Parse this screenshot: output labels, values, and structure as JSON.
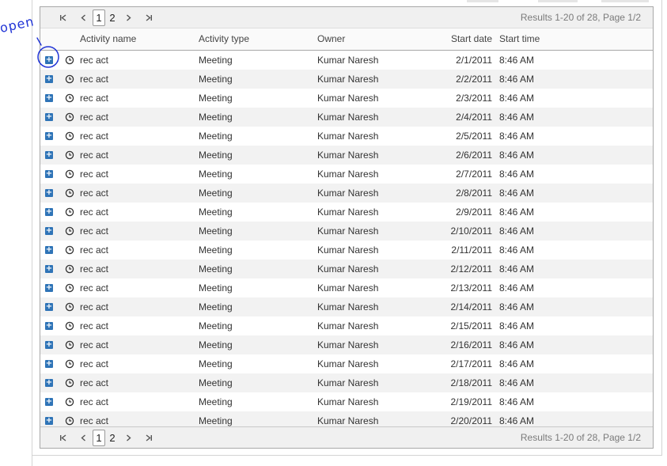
{
  "pager": {
    "pages": [
      "1",
      "2"
    ],
    "current_page": "1",
    "results_text": "Results 1-20 of 28, Page 1/2"
  },
  "annotation": {
    "text": "open"
  },
  "columns": {
    "activity_name": "Activity name",
    "activity_type": "Activity type",
    "owner": "Owner",
    "start_date": "Start date",
    "start_time": "Start time"
  },
  "rows": [
    {
      "name": "rec act",
      "type": "Meeting",
      "owner": "Kumar Naresh",
      "date": "2/1/2011",
      "time": "8:46 AM"
    },
    {
      "name": "rec act",
      "type": "Meeting",
      "owner": "Kumar Naresh",
      "date": "2/2/2011",
      "time": "8:46 AM"
    },
    {
      "name": "rec act",
      "type": "Meeting",
      "owner": "Kumar Naresh",
      "date": "2/3/2011",
      "time": "8:46 AM"
    },
    {
      "name": "rec act",
      "type": "Meeting",
      "owner": "Kumar Naresh",
      "date": "2/4/2011",
      "time": "8:46 AM"
    },
    {
      "name": "rec act",
      "type": "Meeting",
      "owner": "Kumar Naresh",
      "date": "2/5/2011",
      "time": "8:46 AM"
    },
    {
      "name": "rec act",
      "type": "Meeting",
      "owner": "Kumar Naresh",
      "date": "2/6/2011",
      "time": "8:46 AM"
    },
    {
      "name": "rec act",
      "type": "Meeting",
      "owner": "Kumar Naresh",
      "date": "2/7/2011",
      "time": "8:46 AM"
    },
    {
      "name": "rec act",
      "type": "Meeting",
      "owner": "Kumar Naresh",
      "date": "2/8/2011",
      "time": "8:46 AM"
    },
    {
      "name": "rec act",
      "type": "Meeting",
      "owner": "Kumar Naresh",
      "date": "2/9/2011",
      "time": "8:46 AM"
    },
    {
      "name": "rec act",
      "type": "Meeting",
      "owner": "Kumar Naresh",
      "date": "2/10/2011",
      "time": "8:46 AM"
    },
    {
      "name": "rec act",
      "type": "Meeting",
      "owner": "Kumar Naresh",
      "date": "2/11/2011",
      "time": "8:46 AM"
    },
    {
      "name": "rec act",
      "type": "Meeting",
      "owner": "Kumar Naresh",
      "date": "2/12/2011",
      "time": "8:46 AM"
    },
    {
      "name": "rec act",
      "type": "Meeting",
      "owner": "Kumar Naresh",
      "date": "2/13/2011",
      "time": "8:46 AM"
    },
    {
      "name": "rec act",
      "type": "Meeting",
      "owner": "Kumar Naresh",
      "date": "2/14/2011",
      "time": "8:46 AM"
    },
    {
      "name": "rec act",
      "type": "Meeting",
      "owner": "Kumar Naresh",
      "date": "2/15/2011",
      "time": "8:46 AM"
    },
    {
      "name": "rec act",
      "type": "Meeting",
      "owner": "Kumar Naresh",
      "date": "2/16/2011",
      "time": "8:46 AM"
    },
    {
      "name": "rec act",
      "type": "Meeting",
      "owner": "Kumar Naresh",
      "date": "2/17/2011",
      "time": "8:46 AM"
    },
    {
      "name": "rec act",
      "type": "Meeting",
      "owner": "Kumar Naresh",
      "date": "2/18/2011",
      "time": "8:46 AM"
    },
    {
      "name": "rec act",
      "type": "Meeting",
      "owner": "Kumar Naresh",
      "date": "2/19/2011",
      "time": "8:46 AM"
    },
    {
      "name": "rec act",
      "type": "Meeting",
      "owner": "Kumar Naresh",
      "date": "2/20/2011",
      "time": "8:46 AM"
    }
  ],
  "icons": {
    "expand": "expand-plus-icon",
    "clock": "clock-icon",
    "first": "first-page-icon",
    "prev": "prev-page-icon",
    "next": "next-page-icon",
    "last": "last-page-icon"
  },
  "colors": {
    "expand_button": "#2f74b7",
    "annotation_ink": "#1f33d6",
    "alt_row": "#f2f2f2"
  }
}
